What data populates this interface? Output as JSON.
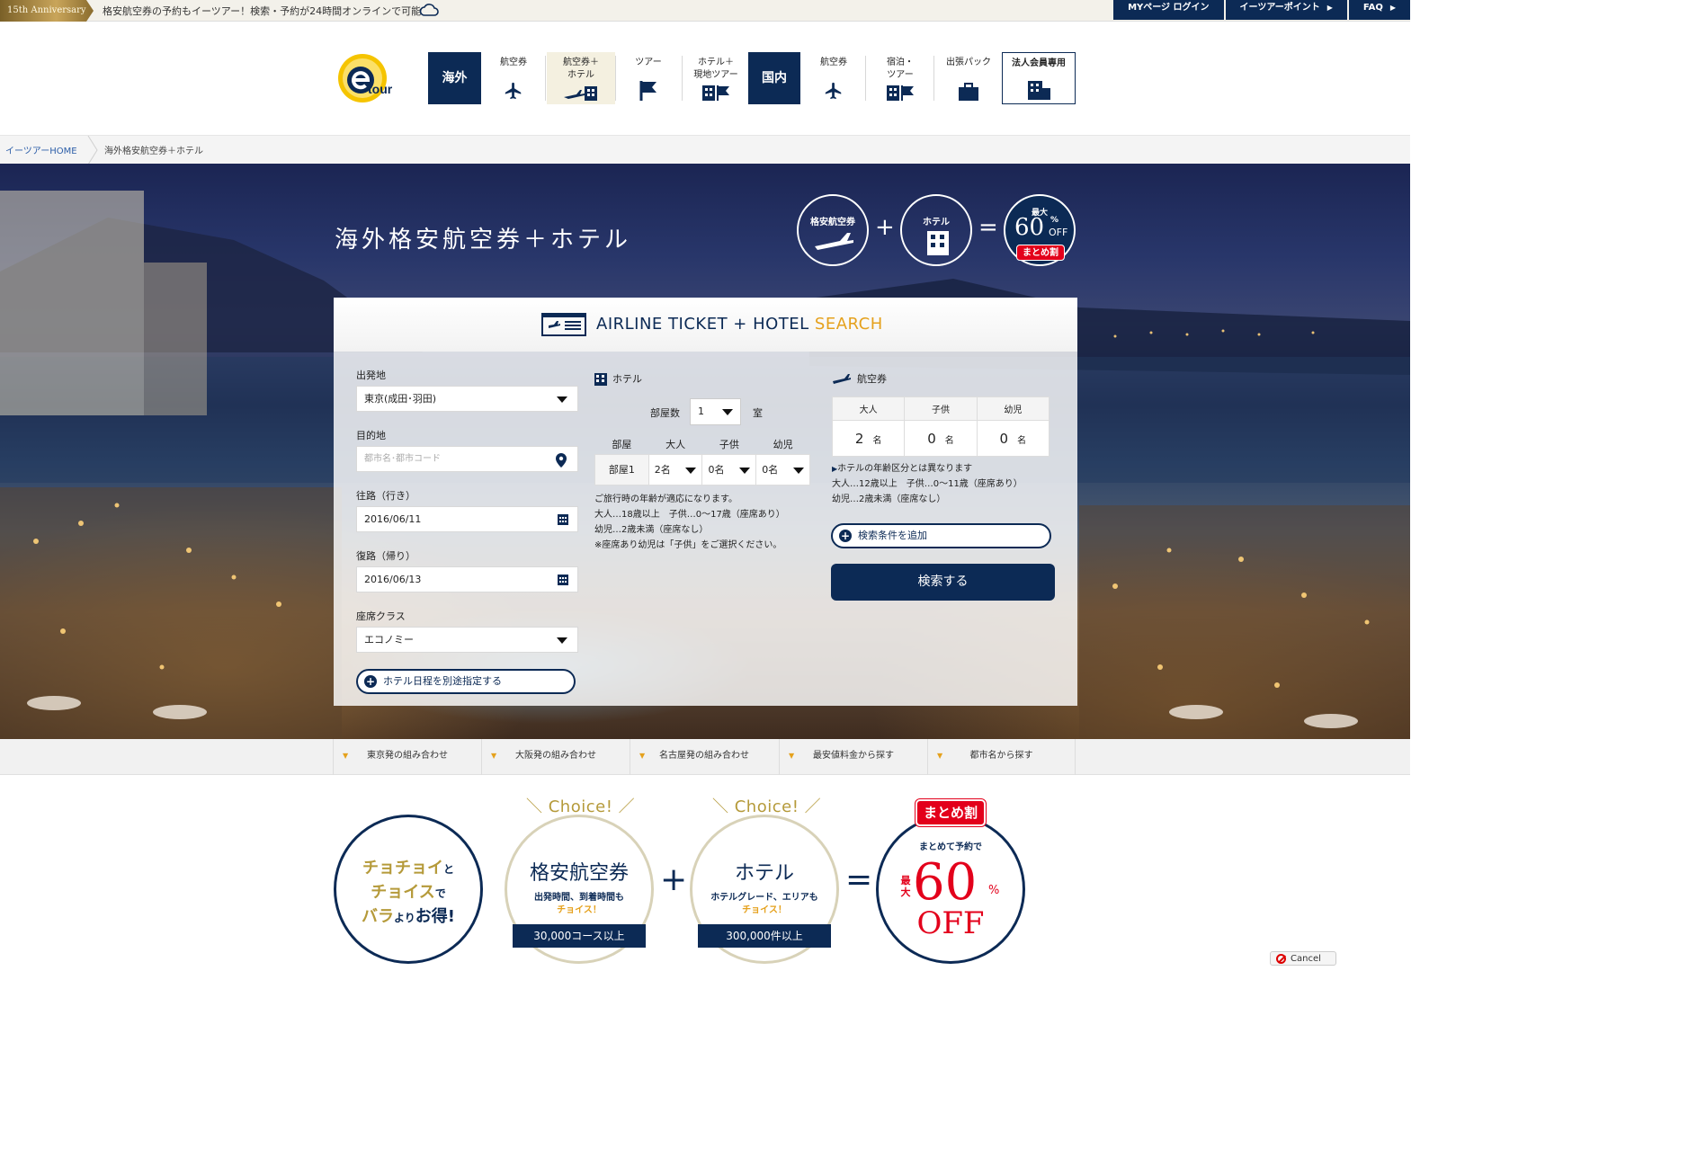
{
  "topbar": {
    "anniversary": "15th Anniversary",
    "message": "格安航空券の予約もイーツアー！検索・予約が24時間オンラインで可能",
    "links": [
      "MYページ ログイン",
      "イーツアーポイント",
      "FAQ"
    ]
  },
  "logo": {
    "text": "tour"
  },
  "nav": {
    "overseas": "海外",
    "domestic": "国内",
    "items": [
      {
        "label": "航空券",
        "icon": "airplane-icon"
      },
      {
        "label": "航空券＋\nホテル",
        "icon": "plane-hotel-icon"
      },
      {
        "label": "ツアー",
        "icon": "flag-icon"
      },
      {
        "label": "ホテル＋\n現地ツアー",
        "icon": "hotel-flag-icon"
      },
      {
        "label": "航空券",
        "icon": "airplane-icon"
      },
      {
        "label": "宿泊・\nツアー",
        "icon": "hotel-flag-icon"
      },
      {
        "label": "出張パック",
        "icon": "briefcase-icon"
      },
      {
        "label": "法人会員専用",
        "icon": "building-icon"
      }
    ]
  },
  "breadcrumb": {
    "home": "イーツアーHOME",
    "current": "海外格安航空券＋ホテル"
  },
  "hero": {
    "title": "海外格安航空券＋ホテル",
    "circle1": "格安航空券",
    "circle2": "ホテル",
    "plus": "+",
    "equals": "=",
    "max": "最大",
    "pct": "60",
    "pct_sign": "%",
    "off": "OFF",
    "matome": "まとめ割"
  },
  "panel": {
    "title_main": "AIRLINE TICKET + HOTEL ",
    "title_accent": "SEARCH",
    "departure_label": "出発地",
    "departure_value": "東京(成田･羽田)",
    "destination_label": "目的地",
    "destination_placeholder": "都市名･都市コード",
    "outbound_label": "往路（行き）",
    "outbound_value": "2016/06/11",
    "return_label": "復路（帰り）",
    "return_value": "2016/06/13",
    "class_label": "座席クラス",
    "class_value": "エコノミー",
    "hotel_date_btn": "ホテル日程を別途指定する",
    "hotel_heading": "ホテル",
    "rooms_label": "部屋数",
    "rooms_value": "1",
    "rooms_unit": "室",
    "room_table_headers": [
      "部屋",
      "大人",
      "子供",
      "幼児"
    ],
    "room_row": {
      "name": "部屋1",
      "adults": "2名",
      "children": "0名",
      "infants": "0名"
    },
    "hotel_notes": [
      "ご旅行時の年齢が適応になります。",
      "大人…18歳以上　子供…0～17歳（座席あり）",
      "幼児…2歳未満（座席なし）",
      "※座席あり幼児は「子供」をご選択ください。"
    ],
    "air_heading": "航空券",
    "air_headers": [
      "大人",
      "子供",
      "幼児"
    ],
    "air_values": [
      "2",
      "0",
      "0"
    ],
    "air_unit": "名",
    "air_notes": [
      "ホテルの年齢区分とは異なります",
      "大人…12歳以上　子供…0～11歳（座席あり）",
      "幼児…2歳未満（座席なし）"
    ],
    "add_condition_btn": "検索条件を追加",
    "search_btn": "検索する"
  },
  "subnav": [
    "東京発の組み合わせ",
    "大阪発の組み合わせ",
    "名古屋発の組み合わせ",
    "最安値料金から探す",
    "都市名から探す"
  ],
  "bottom": {
    "c1": [
      "チョチョイ",
      "と",
      "チョイス",
      "で",
      "バラ",
      "より",
      "お得",
      "!"
    ],
    "choice": "Choice!",
    "c2_title": "格安航空券",
    "c2_sub1": "出発時間、到着時間も",
    "c2_sub2": "チョイス！",
    "c2_badge": "30,000コース以上",
    "c3_title": "ホテル",
    "c3_sub1": "ホテルグレード、エリアも",
    "c3_sub2": "チョイス！",
    "c3_badge": "300,000件以上",
    "plus": "+",
    "equals": "=",
    "c4_tag": "まとめ割",
    "c4_sub": "まとめて予約で",
    "c4_max": "最大",
    "c4_pct": "60",
    "c4_pctsign": "%",
    "c4_off": "OFF"
  },
  "cancel": "Cancel"
}
